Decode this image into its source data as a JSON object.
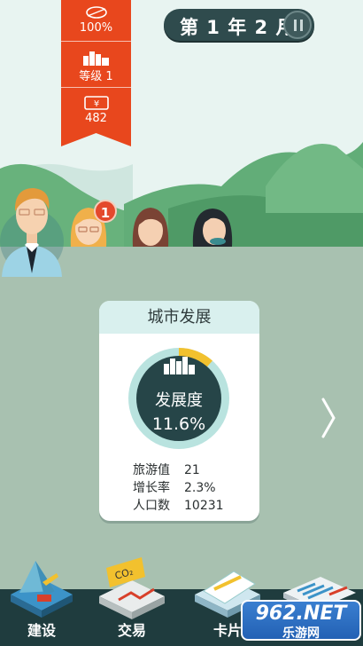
{
  "stats": {
    "energy": "100%",
    "level": "等级 1",
    "money": "482"
  },
  "date": {
    "text": "第 1 年 2 月"
  },
  "notification": {
    "count": "1"
  },
  "city_card": {
    "title": "城市发展",
    "ring_label": "发展度",
    "development": "11.6%",
    "development_fraction": 0.116,
    "rows": [
      {
        "label": "旅游值",
        "value": "21"
      },
      {
        "label": "增长率",
        "value": "2.3%"
      },
      {
        "label": "人口数",
        "value": "10231"
      }
    ]
  },
  "nav": {
    "build": "建设",
    "trade": "交易",
    "cards": "卡片"
  },
  "watermark": {
    "title": "962.NET",
    "subtitle": "乐游网"
  },
  "colors": {
    "banner": "#e8471d",
    "ring_fill": "#f2c12e",
    "ring_track": "#b9e3df",
    "ring_center": "#264548",
    "bottom_bar": "#1f3c3e"
  }
}
